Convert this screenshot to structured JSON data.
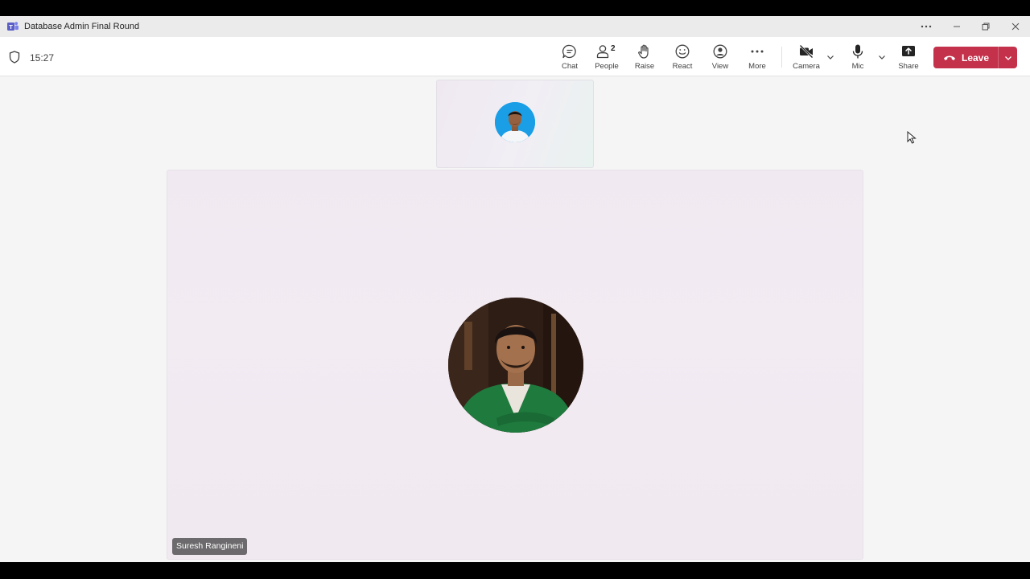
{
  "window": {
    "title": "Database Admin Final Round"
  },
  "meeting": {
    "elapsed_time": "15:27",
    "toolbar": {
      "chat_label": "Chat",
      "people_label": "People",
      "people_count": "2",
      "raise_label": "Raise",
      "react_label": "React",
      "view_label": "View",
      "more_label": "More",
      "camera_label": "Camera",
      "mic_label": "Mic",
      "share_label": "Share",
      "leave_label": "Leave"
    }
  },
  "participants": [
    {
      "tile": "small",
      "avatar": "profile-photo"
    },
    {
      "tile": "main",
      "name": "Suresh Rangineni",
      "avatar": "profile-photo"
    }
  ],
  "colors": {
    "leave_button": "#c4314b",
    "teams_brand": "#5b5fc7"
  }
}
